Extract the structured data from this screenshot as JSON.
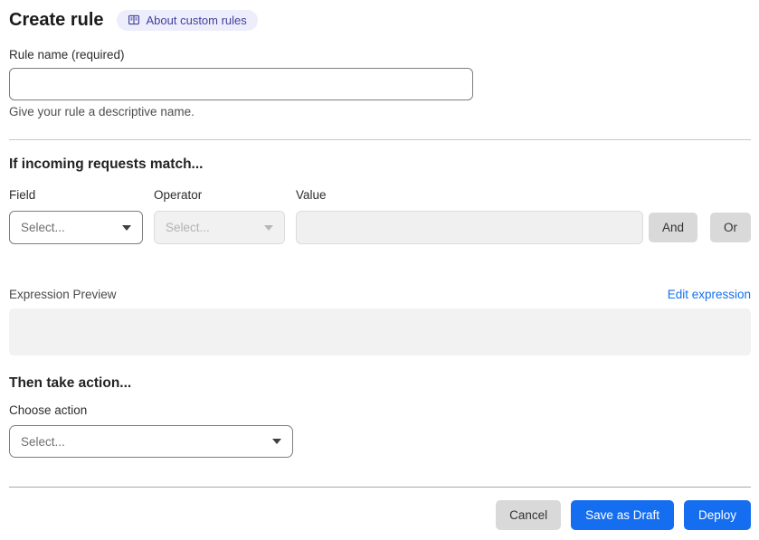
{
  "header": {
    "title": "Create rule",
    "about_badge_label": "About custom rules"
  },
  "rule_name": {
    "label": "Rule name (required)",
    "value": "",
    "helper": "Give your rule a descriptive name."
  },
  "match_section": {
    "heading": "If incoming requests match...",
    "field": {
      "label": "Field",
      "selected": "Select..."
    },
    "operator": {
      "label": "Operator",
      "selected": "Select..."
    },
    "value": {
      "label": "Value",
      "value": ""
    },
    "and_button_label": "And",
    "or_button_label": "Or",
    "expression_preview_label": "Expression Preview",
    "edit_expression_link": "Edit expression",
    "expression_preview_value": ""
  },
  "action_section": {
    "heading": "Then take action...",
    "choose_action_label": "Choose action",
    "action_select": {
      "selected": "Select..."
    }
  },
  "footer": {
    "cancel_label": "Cancel",
    "save_draft_label": "Save as Draft",
    "deploy_label": "Deploy"
  },
  "icons": {
    "badge_icon": "book-icon",
    "select_icon": "caret-down-icon"
  },
  "colors": {
    "primary_blue": "#156ef0",
    "link_blue": "#1570ef",
    "badge_bg": "#ededfb",
    "badge_text": "#41419f",
    "gray_button_bg": "#d9d9d9",
    "disabled_bg": "#f1f1f1",
    "preview_box_bg": "#f2f2f2",
    "enabled_border": "#7e7e7e",
    "disabled_border": "#dcdcdc"
  }
}
